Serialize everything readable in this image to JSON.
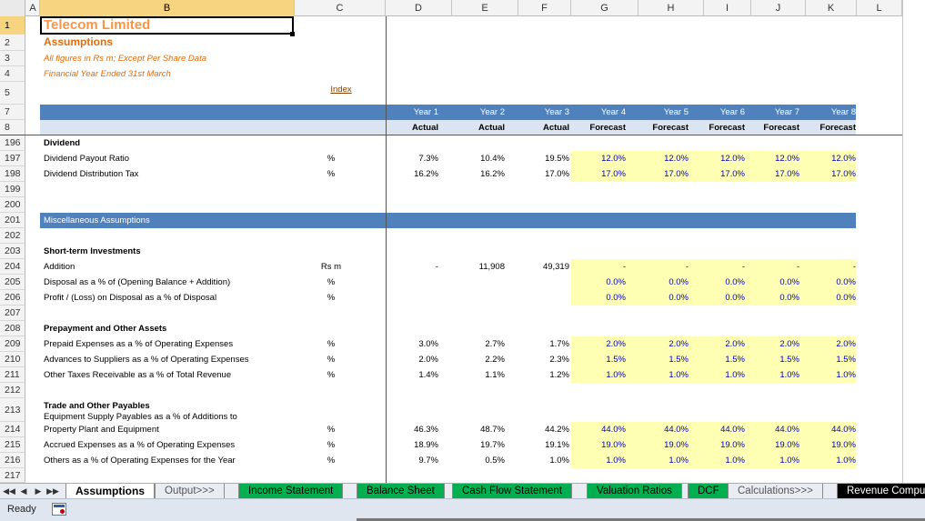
{
  "columns": [
    "A",
    "B",
    "C",
    "D",
    "E",
    "F",
    "G",
    "H",
    "I",
    "J",
    "K",
    "L"
  ],
  "rows": [
    "1",
    "2",
    "3",
    "4",
    "5",
    "7",
    "8",
    "196",
    "197",
    "198",
    "199",
    "200",
    "201",
    "202",
    "203",
    "204",
    "205",
    "206",
    "207",
    "208",
    "209",
    "210",
    "211",
    "212",
    "213",
    "214",
    "215",
    "216",
    "217"
  ],
  "header": {
    "title": "Telecom Limited",
    "subtitle": "Assumptions",
    "note1": "All figures in Rs m; Except Per Share Data",
    "note2": "Financial Year Ended 31st March",
    "index_link": "Index",
    "years": [
      "Year 1",
      "Year 2",
      "Year 3",
      "Year 4",
      "Year 5",
      "Year 6",
      "Year 7",
      "Year 8"
    ],
    "types": [
      "Actual",
      "Actual",
      "Actual",
      "Forecast",
      "Forecast",
      "Forecast",
      "Forecast",
      "Forecast"
    ]
  },
  "body": {
    "dividend": {
      "heading": "Dividend",
      "payout": {
        "label": "Dividend Payout Ratio",
        "unit": "%",
        "values": [
          "7.3%",
          "10.4%",
          "19.5%",
          "12.0%",
          "12.0%",
          "12.0%",
          "12.0%",
          "12.0%"
        ]
      },
      "tax": {
        "label": "Dividend Distribution Tax",
        "unit": "%",
        "values": [
          "16.2%",
          "16.2%",
          "17.0%",
          "17.0%",
          "17.0%",
          "17.0%",
          "17.0%",
          "17.0%"
        ]
      }
    },
    "misc_heading": "Miscellaneous Assumptions",
    "sti": {
      "heading": "Short-term Investments",
      "addition": {
        "label": "Addition",
        "unit": "Rs m",
        "values": [
          "-",
          "11,908",
          "49,319",
          "-",
          "-",
          "-",
          "-",
          "-"
        ]
      },
      "disposal": {
        "label": "Disposal as a % of (Opening Balance + Addition)",
        "unit": "%",
        "values": [
          "",
          "",
          "",
          "0.0%",
          "0.0%",
          "0.0%",
          "0.0%",
          "0.0%"
        ]
      },
      "profit": {
        "label": "Profit / (Loss) on Disposal as a % of Disposal",
        "unit": "%",
        "values": [
          "",
          "",
          "",
          "0.0%",
          "0.0%",
          "0.0%",
          "0.0%",
          "0.0%"
        ]
      }
    },
    "prepay": {
      "heading": "Prepayment and Other Assets",
      "prepaid": {
        "label": "Prepaid Expenses as a % of Operating Expenses",
        "unit": "%",
        "values": [
          "3.0%",
          "2.7%",
          "1.7%",
          "2.0%",
          "2.0%",
          "2.0%",
          "2.0%",
          "2.0%"
        ]
      },
      "advances": {
        "label": "Advances to Suppliers as a % of Operating Expenses",
        "unit": "%",
        "values": [
          "2.0%",
          "2.2%",
          "2.3%",
          "1.5%",
          "1.5%",
          "1.5%",
          "1.5%",
          "1.5%"
        ]
      },
      "taxes": {
        "label": "Other Taxes Receivable as a % of Total Revenue",
        "unit": "%",
        "values": [
          "1.4%",
          "1.1%",
          "1.2%",
          "1.0%",
          "1.0%",
          "1.0%",
          "1.0%",
          "1.0%"
        ]
      }
    },
    "trade": {
      "heading": "Trade and Other Payables",
      "equip": {
        "label1": "Equipment Supply Payables as a % of Additions to",
        "label2": "Property Plant and Equipment",
        "unit": "%",
        "values": [
          "46.3%",
          "48.7%",
          "44.2%",
          "44.0%",
          "44.0%",
          "44.0%",
          "44.0%",
          "44.0%"
        ]
      },
      "accrued": {
        "label": "Accrued Expenses as a % of Operating Expenses",
        "unit": "%",
        "values": [
          "18.9%",
          "19.7%",
          "19.1%",
          "19.0%",
          "19.0%",
          "19.0%",
          "19.0%",
          "19.0%"
        ]
      },
      "others": {
        "label": "Others as a % of Operating Expenses for the Year",
        "unit": "%",
        "values": [
          "9.7%",
          "0.5%",
          "1.0%",
          "1.0%",
          "1.0%",
          "1.0%",
          "1.0%",
          "1.0%"
        ]
      }
    }
  },
  "nav": {
    "first": "◀◀",
    "prev": "◀",
    "next": "▶",
    "last": "▶▶"
  },
  "tabs": [
    "Assumptions",
    "Output>>>",
    "Income Statement",
    "Balance Sheet",
    "Cash Flow Statement",
    "Valuation Ratios",
    "DCF",
    "Calculations>>>",
    "Revenue Compu"
  ],
  "status": {
    "text": "Ready"
  },
  "colors": {
    "accent_blue": "#4f81bd",
    "input_yellow": "#ffffb3",
    "tab_green": "#00b050",
    "title_orange": "#f79646"
  }
}
